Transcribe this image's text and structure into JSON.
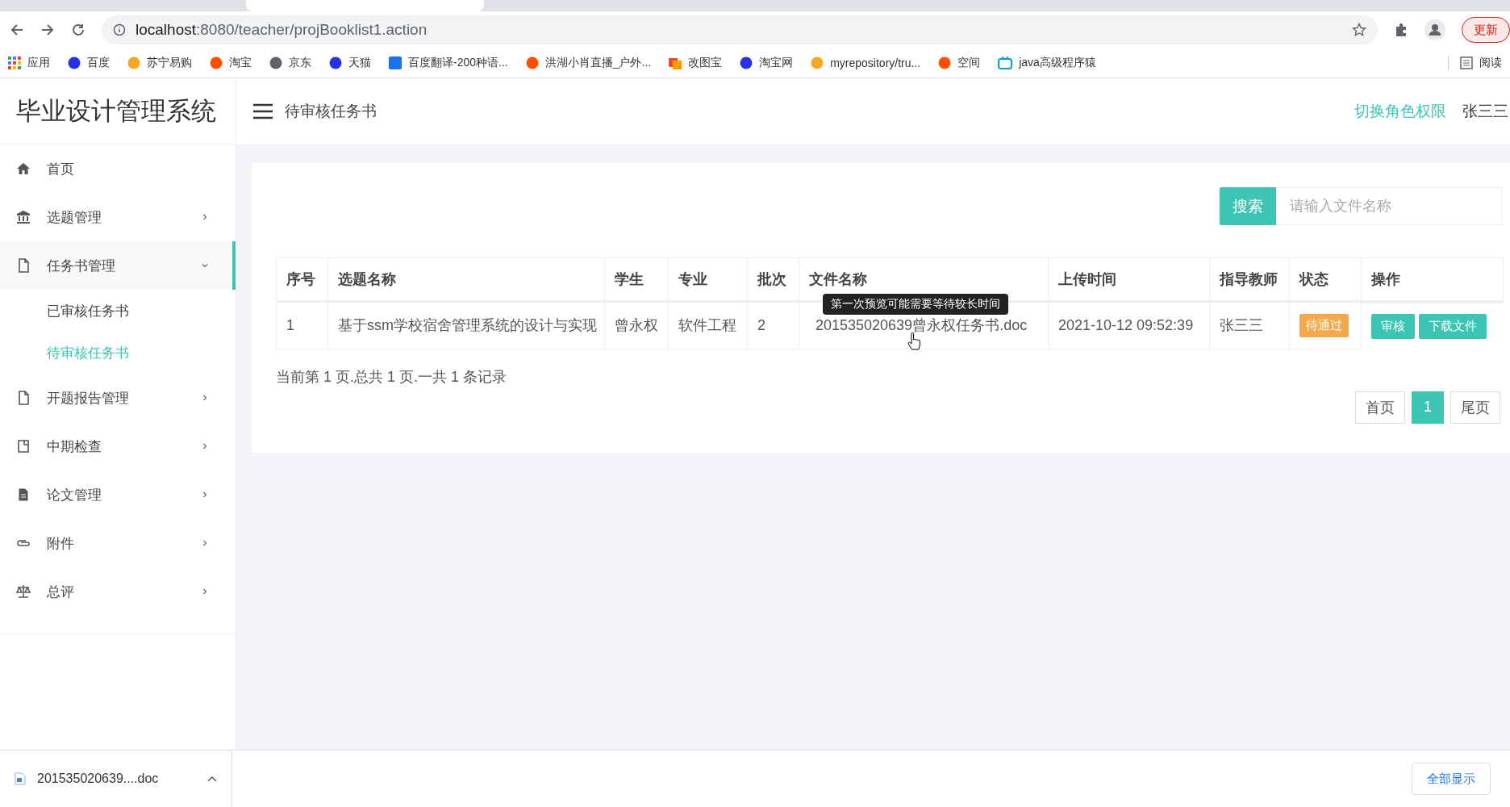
{
  "browser": {
    "url_host": "localhost",
    "url_path": ":8080/teacher/projBooklist1.action",
    "update_button": "更新",
    "bookmarks": [
      {
        "label": "应用"
      },
      {
        "label": "百度"
      },
      {
        "label": "苏宁易购"
      },
      {
        "label": "淘宝"
      },
      {
        "label": "京东"
      },
      {
        "label": "天猫"
      },
      {
        "label": "百度翻译-200种语..."
      },
      {
        "label": "洪湖小肖直播_户外..."
      },
      {
        "label": "改图宝"
      },
      {
        "label": "淘宝网"
      },
      {
        "label": "myrepository/tru..."
      },
      {
        "label": "空间"
      },
      {
        "label": "java高级程序猿"
      }
    ],
    "reading_list": "阅读"
  },
  "sidebar": {
    "title": "毕业设计管理系统",
    "items": [
      {
        "label": "首页",
        "selected": false
      },
      {
        "label": "选题管理",
        "selected": false,
        "expanded": false
      },
      {
        "label": "任务书管理",
        "selected": true,
        "expanded": true,
        "children": [
          {
            "label": "已审核任务书",
            "selected": false
          },
          {
            "label": "待审核任务书",
            "selected": true
          }
        ]
      },
      {
        "label": "开题报告管理",
        "selected": false,
        "expanded": false
      },
      {
        "label": "中期检查",
        "selected": false,
        "expanded": false
      },
      {
        "label": "论文管理",
        "selected": false,
        "expanded": false
      },
      {
        "label": "附件",
        "selected": false,
        "expanded": false
      },
      {
        "label": "总评",
        "selected": false,
        "expanded": false
      }
    ]
  },
  "header": {
    "title": "待审核任务书",
    "switch_role": "切换角色权限",
    "user": "张三三"
  },
  "search": {
    "button": "搜索",
    "placeholder": "请输入文件名称"
  },
  "table": {
    "columns": [
      "序号",
      "选题名称",
      "学生",
      "专业",
      "批次",
      "文件名称",
      "上传时间",
      "指导教师",
      "状态",
      "操作"
    ],
    "rows": [
      {
        "cells": [
          "1",
          "基于ssm学校宿舍管理系统的设计与实现",
          "曾永权",
          "软件工程",
          "2",
          "201535020639曾永权任务书.doc",
          "2021-10-12 09:52:39",
          "张三三"
        ],
        "status": "待通过",
        "actions": [
          "审核",
          "下载文件"
        ]
      }
    ]
  },
  "tooltip": "第一次预览可能需要等待较长时间",
  "summary": "当前第 1 页.总共 1 页.一共 1 条记录",
  "pagination": [
    {
      "label": "首页",
      "selected": false
    },
    {
      "label": "1",
      "selected": true
    },
    {
      "label": "尾页",
      "selected": false
    }
  ],
  "download_bar": {
    "file": "201535020639....doc",
    "show_all": "全部显示"
  }
}
